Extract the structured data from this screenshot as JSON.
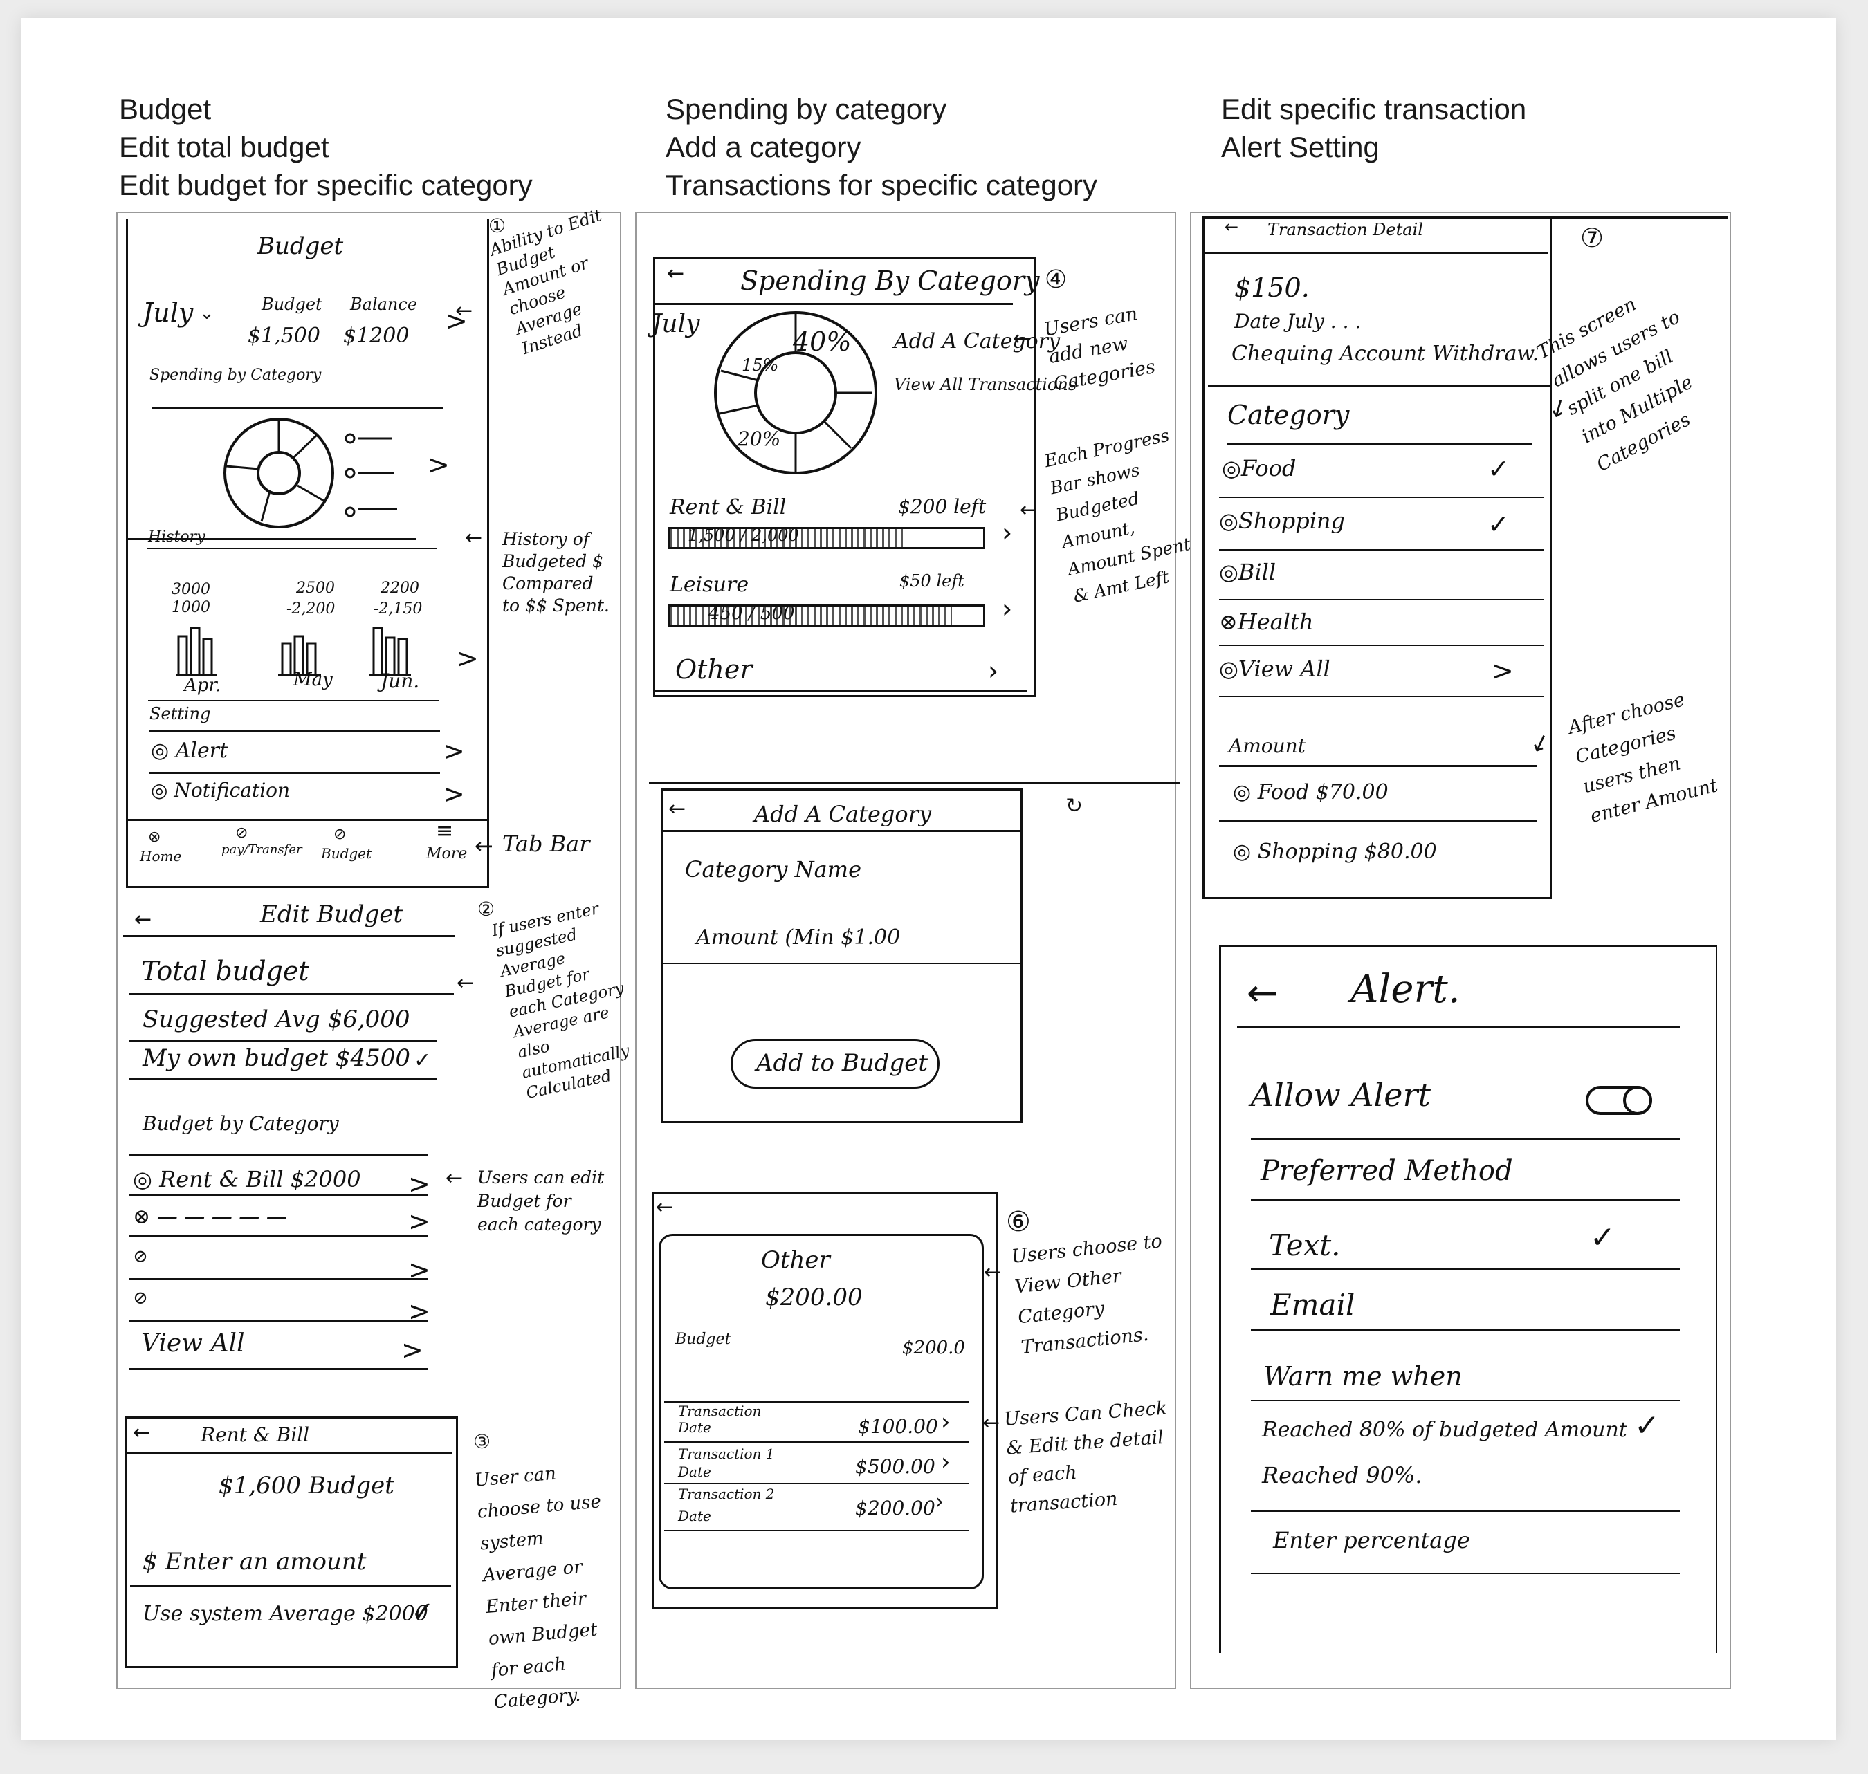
{
  "headers": {
    "col1": [
      "Budget",
      "Edit total budget",
      "Edit budget for specific category"
    ],
    "col2": [
      "Spending by category",
      "Add a category",
      "Transactions for specific category"
    ],
    "col3": [
      "Edit specific transaction",
      "Alert Setting"
    ]
  },
  "budget_screen": {
    "number": "①",
    "title": "Budget",
    "month": "July",
    "budget_label": "Budget",
    "budget_value": "$1,500",
    "balance_label": "Balance",
    "balance_value": "$1200",
    "spending_label": "Spending by Category",
    "history_label": "History",
    "history": [
      {
        "month": "Apr.",
        "top": "3000",
        "bottom": "1000"
      },
      {
        "month": "May",
        "top": "2500",
        "bottom": "-2,200"
      },
      {
        "month": "Jun.",
        "top": "2200",
        "bottom": "-2,150"
      }
    ],
    "setting_label": "Setting",
    "settings": [
      "Alert",
      "Notification"
    ],
    "tabs": [
      "Home",
      "pay/Transfer",
      "Budget",
      "More"
    ],
    "notes": {
      "ability": "Ability to Edit Budget Amount or choose Average Instead",
      "history": "History of Budgeted $ Compared to $$ Spent.",
      "tabbar": "Tab Bar"
    }
  },
  "edit_budget": {
    "number": "②",
    "title": "Edit Budget",
    "total_budget": "Total budget",
    "suggested": "Suggested Avg $6,000",
    "own": "My own budget $4500",
    "by_category": "Budget by Category",
    "rows": [
      "Rent & Bill $2000",
      "",
      "",
      "",
      "View All"
    ],
    "notes": {
      "suggested": "If users enter suggested Average Budget for each Category Average are also automatically Calculated",
      "each": "Users can edit Budget for each category"
    }
  },
  "rent_bill": {
    "number": "③",
    "title": "Rent & Bill",
    "budget": "$1,600 Budget",
    "enter": "$ Enter an amount",
    "system": "Use system Average $2000",
    "note": "User can choose to use system Average or Enter their own Budget for each Category."
  },
  "spending": {
    "number": "④",
    "title": "Spending By Category",
    "month": "July",
    "pcts": [
      "40%",
      "15%",
      "20%"
    ],
    "add": "Add A Category",
    "view_all": "View All Transactions",
    "rows": [
      {
        "name": "Rent & Bill",
        "left": "$200 left",
        "amount": "1,500 / 2,000"
      },
      {
        "name": "Leisure",
        "left": "$50 left",
        "amount": "450 / 500"
      }
    ],
    "other": "Other",
    "notes": {
      "add": "Users can add new Categories",
      "progress": "Each Progress Bar shows Budgeted Amount, Amount Spent & Amt Left"
    }
  },
  "add_category": {
    "title": "Add A Category",
    "name_label": "Category Name",
    "amount_label": "Amount (Min $1.00",
    "button": "Add to Budget"
  },
  "other_screen": {
    "number": "⑥",
    "title": "Other",
    "amount": "$200.00",
    "budget_label": "Budget",
    "budget_value": "$200.0",
    "transactions": [
      {
        "name": "Transaction",
        "date": "Date",
        "amount": "$100.00"
      },
      {
        "name": "Transaction 1",
        "date": "Date",
        "amount": "$500.00"
      },
      {
        "name": "Transaction 2",
        "date": "Date",
        "amount": "$200.00"
      }
    ],
    "notes": {
      "view": "Users choose to View Other Category Transactions.",
      "check": "Users Can Check & Edit the detail of each transaction"
    }
  },
  "transaction_detail": {
    "number": "⑦",
    "title": "Transaction Detail",
    "amount": "$150.",
    "date": "Date July . . .",
    "account": "Chequing Account Withdraw.",
    "category_label": "Category",
    "categories": [
      {
        "name": "Food",
        "checked": true
      },
      {
        "name": "Shopping",
        "checked": true
      },
      {
        "name": "Bill",
        "checked": false
      },
      {
        "name": "Health",
        "checked": false
      },
      {
        "name": "View All",
        "checked": false
      }
    ],
    "amount_label": "Amount",
    "amounts": [
      "Food $70.00",
      "Shopping $80.00"
    ],
    "notes": {
      "split": "This screen allows users to split one bill into Multiple Categories",
      "after": "After choose Categories users then enter Amount"
    }
  },
  "alert": {
    "title": "Alert.",
    "allow": "Allow Alert",
    "preferred": "Preferred Method",
    "text": "Text.",
    "email": "Email",
    "warn": "Warn me when",
    "reached80": "Reached 80% of budgeted Amount",
    "reached90": "Reached 90%.",
    "enter_pct": "Enter percentage"
  }
}
